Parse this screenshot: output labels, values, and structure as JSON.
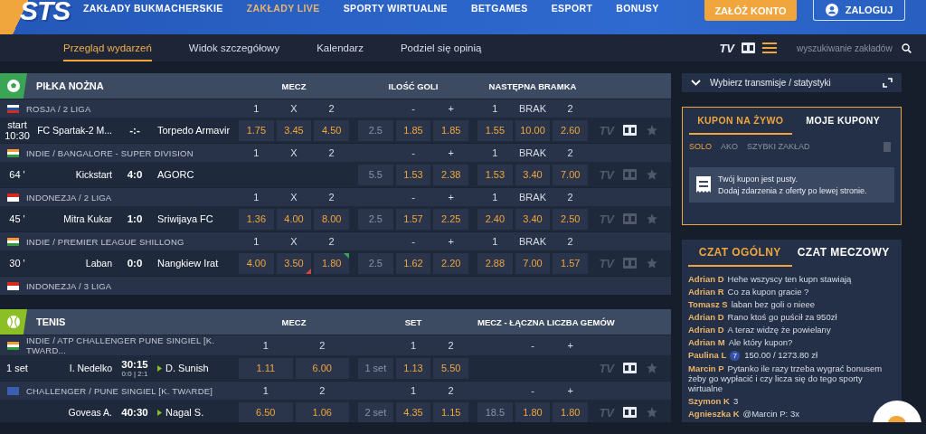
{
  "logo": "STS",
  "nav": [
    {
      "label": "ZAKŁADY BUKMACHERSKIE",
      "selected": false
    },
    {
      "label": "ZAKŁADY LIVE",
      "selected": true
    },
    {
      "label": "SPORTY WIRTUALNE",
      "selected": false
    },
    {
      "label": "BETGAMES",
      "selected": false
    },
    {
      "label": "ESPORT",
      "selected": false
    },
    {
      "label": "BONUSY",
      "selected": false
    }
  ],
  "account": {
    "register": "ZAŁÓŻ KONTO",
    "login": "ZALOGUJ"
  },
  "subnav": [
    {
      "label": "Przegląd wydarzeń",
      "selected": true
    },
    {
      "label": "Widok szczegółowy",
      "selected": false
    },
    {
      "label": "Kalendarz",
      "selected": false
    },
    {
      "label": "Podziel się opinią",
      "selected": false
    }
  ],
  "tools": {
    "tv": "TV",
    "search_placeholder": "wyszukiwanie zakładów"
  },
  "sections": [
    {
      "kind": "football",
      "title": "PIŁKA NOŻNA",
      "markets": [
        {
          "title": "MECZ",
          "line": false
        },
        {
          "title": "ILOŚĆ GOLI",
          "line": true
        },
        {
          "title": "NASTĘPNA BRAMKA",
          "line": false
        }
      ],
      "leagues": [
        {
          "name": "ROSJA / 2 LIGA",
          "flag": [
            {
              "color": "#ffffff"
            },
            {
              "color": "#1c57a5"
            },
            {
              "color": "#d52b1e"
            }
          ],
          "labels": [
            [
              "1",
              "X",
              "2"
            ],
            [
              "-",
              "+"
            ],
            [
              "1",
              "BRAK",
              "2"
            ]
          ],
          "matches": [
            {
              "time": "start 10:30",
              "home": "FC Spartak-2 M...",
              "score": "-:-",
              "away": "Torpedo Armavir",
              "tv": "TV",
              "stats_available": true,
              "groups": [
                {
                  "kind": "odds",
                  "odds": [
                    {
                      "value": "1.75"
                    },
                    {
                      "value": "3.45"
                    },
                    {
                      "value": "4.50"
                    }
                  ]
                },
                {
                  "kind": "odds",
                  "line": "2.5",
                  "odds": [
                    {
                      "value": "1.85"
                    },
                    {
                      "value": "1.85"
                    }
                  ]
                },
                {
                  "kind": "odds",
                  "odds": [
                    {
                      "value": "1.55"
                    },
                    {
                      "value": "10.00"
                    },
                    {
                      "value": "2.60"
                    }
                  ]
                }
              ]
            }
          ]
        },
        {
          "name": "INDIE / BANGALORE - SUPER DIVISION",
          "flag": [
            {
              "color": "#f29a3a"
            },
            {
              "color": "#ffffff"
            },
            {
              "color": "#2f9a3e"
            }
          ],
          "labels": [
            [
              "1",
              "X",
              "2"
            ],
            [
              "-",
              "+"
            ],
            [
              "1",
              "BRAK",
              "2"
            ]
          ],
          "matches": [
            {
              "time": "64 '",
              "home": "Kickstart",
              "score": "4:0",
              "away": "AGORC",
              "tv": "TV",
              "stats_available": false,
              "groups": [
                {
                  "kind": "blank"
                },
                {
                  "kind": "odds",
                  "line": "5.5",
                  "odds": [
                    {
                      "value": "1.53"
                    },
                    {
                      "value": "2.38"
                    }
                  ]
                },
                {
                  "kind": "odds",
                  "odds": [
                    {
                      "value": "1.53"
                    },
                    {
                      "value": "3.40"
                    },
                    {
                      "value": "7.00"
                    }
                  ]
                }
              ]
            }
          ]
        },
        {
          "name": "INDONEZJA / 2 LIGA",
          "flag": [
            {
              "color": "#d52b1e"
            },
            {
              "color": "#ffffff"
            }
          ],
          "labels": [
            [
              "1",
              "X",
              "2"
            ],
            [
              "-",
              "+"
            ],
            [
              "1",
              "BRAK",
              "2"
            ]
          ],
          "matches": [
            {
              "time": "45 '",
              "home": "Mitra Kukar",
              "score": "1:0",
              "away": "Sriwijaya FC",
              "tv": "TV",
              "stats_available": false,
              "groups": [
                {
                  "kind": "odds",
                  "odds": [
                    {
                      "value": "1.36"
                    },
                    {
                      "value": "4.00"
                    },
                    {
                      "value": "8.00"
                    }
                  ]
                },
                {
                  "kind": "odds",
                  "line": "2.5",
                  "odds": [
                    {
                      "value": "1.57"
                    },
                    {
                      "value": "2.25"
                    }
                  ]
                },
                {
                  "kind": "odds",
                  "odds": [
                    {
                      "value": "2.40"
                    },
                    {
                      "value": "3.40"
                    },
                    {
                      "value": "2.50"
                    }
                  ]
                }
              ]
            }
          ]
        },
        {
          "name": "INDIE / PREMIER LEAGUE SHILLONG",
          "flag": [
            {
              "color": "#f29a3a"
            },
            {
              "color": "#ffffff"
            },
            {
              "color": "#2f9a3e"
            }
          ],
          "labels": [
            [
              "1",
              "X",
              "2"
            ],
            [
              "-",
              "+"
            ],
            [
              "1",
              "BRAK",
              "2"
            ]
          ],
          "matches": [
            {
              "time": "30 '",
              "home": "Laban",
              "score": "0:0",
              "away": "Nangkiew Irat",
              "tv": "TV",
              "stats_available": false,
              "groups": [
                {
                  "kind": "odds",
                  "odds": [
                    {
                      "kind": "steady",
                      "value": "4.00"
                    },
                    {
                      "kind": "falling",
                      "value": "3.50"
                    },
                    {
                      "kind": "rising",
                      "value": "1.80"
                    }
                  ]
                },
                {
                  "kind": "odds",
                  "line": "2.5",
                  "odds": [
                    {
                      "value": "1.62"
                    },
                    {
                      "value": "2.20"
                    }
                  ]
                },
                {
                  "kind": "odds",
                  "odds": [
                    {
                      "value": "2.88"
                    },
                    {
                      "value": "7.00"
                    },
                    {
                      "value": "1.57"
                    }
                  ]
                }
              ]
            }
          ]
        },
        {
          "name": "INDONEZJA / 3 LIGA",
          "flag": [
            {
              "color": "#d52b1e"
            },
            {
              "color": "#ffffff"
            }
          ]
        }
      ]
    },
    {
      "kind": "tennis",
      "title": "TENIS",
      "markets": [
        {
          "title": "MECZ",
          "line": false
        },
        {
          "title": "SET",
          "line": true
        },
        {
          "title": "MECZ - ŁĄCZNA LICZBA GEMÓW",
          "line": true
        }
      ],
      "leagues": [
        {
          "name": "INDIE / ATP CHALLENGER PUNE SINGIEL [K. TWARD...",
          "flag": [
            {
              "color": "#f29a3a"
            },
            {
              "color": "#ffffff"
            },
            {
              "color": "#2f9a3e"
            }
          ],
          "labels": [
            [
              "1",
              "2"
            ],
            [
              "1",
              "2"
            ],
            [
              "-",
              "+"
            ]
          ],
          "matches": [
            {
              "time": "1 set",
              "home": "I. Nedelko",
              "score": "30:15",
              "sets": "0:0 | 2:1",
              "away_serving": true,
              "away": "D. Sunish",
              "tv": "TV",
              "stats_available": true,
              "groups": [
                {
                  "kind": "odds",
                  "odds": [
                    {
                      "value": "1.11"
                    },
                    {
                      "value": "6.00"
                    }
                  ]
                },
                {
                  "kind": "odds",
                  "line": "1 set",
                  "odds": [
                    {
                      "value": "1.13"
                    },
                    {
                      "value": "5.50"
                    }
                  ]
                },
                {
                  "kind": "blank"
                }
              ]
            }
          ]
        },
        {
          "name": "CHALLENGER / PUNE SINGIEL [K. TWARDE]",
          "flag": [
            {
              "color": "#3a5fb0"
            }
          ],
          "labels": [
            [
              "1",
              "2"
            ],
            [
              "1",
              "2"
            ],
            [
              "-",
              "+"
            ]
          ],
          "matches": [
            {
              "home": "Goveas A.",
              "score": "40:30",
              "away_serving": true,
              "away": "Nagal S.",
              "tv": "TV",
              "stats_available": true,
              "groups": [
                {
                  "kind": "odds",
                  "odds": [
                    {
                      "value": "6.50"
                    },
                    {
                      "value": "1.06"
                    }
                  ]
                },
                {
                  "kind": "odds",
                  "line": "2 set",
                  "odds": [
                    {
                      "value": "4.35"
                    },
                    {
                      "value": "1.15"
                    }
                  ]
                },
                {
                  "kind": "odds",
                  "line": "18.5",
                  "odds": [
                    {
                      "value": "1.80"
                    },
                    {
                      "value": "1.80"
                    }
                  ]
                }
              ]
            }
          ]
        }
      ]
    }
  ],
  "stream": {
    "label": "Wybierz transmisje / statystyki"
  },
  "coupon": {
    "tabs": [
      {
        "label": "KUPON NA ŻYWO",
        "selected": true
      },
      {
        "label": "MOJE KUPONY",
        "selected": false
      }
    ],
    "modes": [
      {
        "label": "SOLO",
        "selected": true
      },
      {
        "label": "AKO",
        "selected": false
      },
      {
        "label": "SZYBKI ZAKŁAD",
        "selected": false
      }
    ],
    "empty_title": "Twój kupon jest pusty.",
    "empty_hint": "Dodaj zdarzenia z oferty po lewej stronie."
  },
  "chat": {
    "tabs": [
      {
        "label": "CZAT OGÓLNY",
        "selected": true
      },
      {
        "label": "CZAT MECZOWY",
        "selected": false
      }
    ],
    "messages": [
      {
        "kind": "text",
        "author": "Adrian D",
        "text": "Hehe wszyscy ten kupn stawiają"
      },
      {
        "kind": "text",
        "author": "Adrian R",
        "text": "Co za kupon gracie ?"
      },
      {
        "kind": "text",
        "author": "Tomasz S",
        "text": "laban bez goli o nieee"
      },
      {
        "kind": "text",
        "author": "Adrian D",
        "text": "Rano ktoś go puścił za 950zł"
      },
      {
        "kind": "text",
        "author": "Adrian D",
        "text": "A teraz widzę że powielany"
      },
      {
        "kind": "text",
        "author": "Adrian M",
        "text": "Ale który kupon?"
      },
      {
        "kind": "coupon",
        "author": "Paulina L",
        "badge": "7",
        "text": "150.00 / 1273.80 zł"
      },
      {
        "kind": "text",
        "author": "Marcin P",
        "text": "Pytanko ile razy trzeba wygrać bonusem żeby go wypłacić i czy licza się do tego sporty wirtualne"
      },
      {
        "kind": "text",
        "author": "Szymon K",
        "text": "3"
      },
      {
        "kind": "text",
        "author": "Agnieszka K",
        "text": "@Marcin P: 3x"
      }
    ]
  }
}
